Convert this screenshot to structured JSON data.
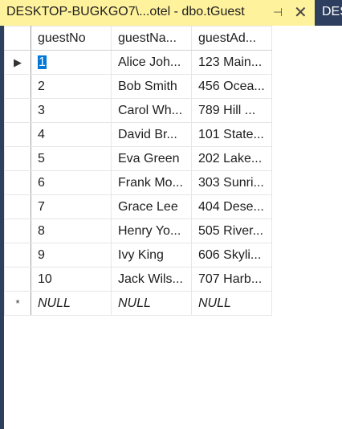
{
  "tab": {
    "title": "DESKTOP-BUGKGO7\\...otel - dbo.tGuest",
    "pin_icon": "pin-icon",
    "close_icon": "close-icon",
    "next_tab_title": "DES"
  },
  "grid": {
    "columns": [
      "guestNo",
      "guestNa...",
      "guestAd..."
    ],
    "rows": [
      [
        "1",
        "Alice Joh...",
        "123 Main..."
      ],
      [
        "2",
        "Bob Smith",
        "456 Ocea..."
      ],
      [
        "3",
        "Carol Wh...",
        "789 Hill ..."
      ],
      [
        "4",
        "David Br...",
        "101 State..."
      ],
      [
        "5",
        "Eva Green",
        "202 Lake..."
      ],
      [
        "6",
        "Frank Mo...",
        "303 Sunri..."
      ],
      [
        "7",
        "Grace Lee",
        "404 Dese..."
      ],
      [
        "8",
        "Henry Yo...",
        "505 River..."
      ],
      [
        "9",
        "Ivy King",
        "606 Skyli..."
      ],
      [
        "10",
        "Jack Wils...",
        "707 Harb..."
      ]
    ],
    "new_row": [
      "NULL",
      "NULL",
      "NULL"
    ],
    "current_row_marker": "▶",
    "new_row_marker": "*"
  }
}
